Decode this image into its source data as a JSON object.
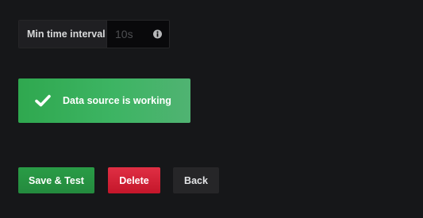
{
  "interval": {
    "label": "Min time interval",
    "placeholder": "10s",
    "value": "",
    "info_icon": "info-circle-icon"
  },
  "alert": {
    "icon": "check-icon",
    "message": "Data source is working",
    "color": "#3db463"
  },
  "actions": {
    "save_label": "Save & Test",
    "delete_label": "Delete",
    "back_label": "Back",
    "save_color": "#299c46",
    "delete_color": "#d44a3a",
    "back_color": "#262628"
  }
}
